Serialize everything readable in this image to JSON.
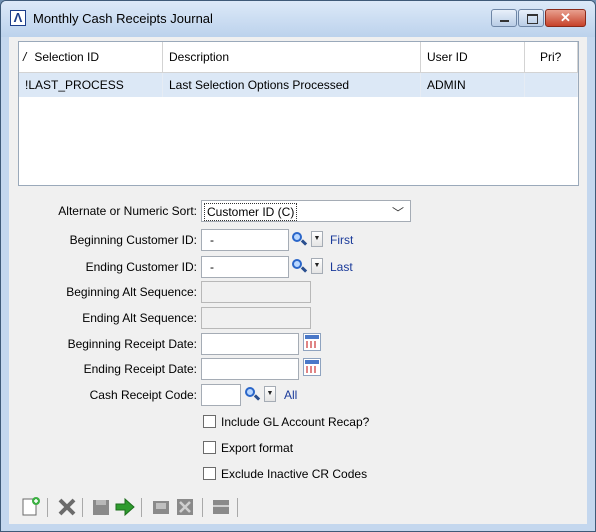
{
  "window": {
    "title": "Monthly Cash Receipts Journal"
  },
  "grid": {
    "sort_indicator": "/",
    "columns": [
      "Selection ID",
      "Description",
      "User ID",
      "Pri?"
    ],
    "rows": [
      [
        "!LAST_PROCESS",
        "Last Selection Options Processed",
        "ADMIN",
        ""
      ]
    ]
  },
  "form": {
    "alt_sort_label": "Alternate or Numeric Sort:",
    "alt_sort_value": "Customer ID (C)",
    "beg_cust_label": "Beginning Customer ID:",
    "beg_cust_value": "-",
    "beg_cust_link": "First",
    "end_cust_label": "Ending Customer ID:",
    "end_cust_value": "-",
    "end_cust_link": "Last",
    "beg_alt_label": "Beginning Alt Sequence:",
    "end_alt_label": "Ending Alt Sequence:",
    "beg_date_label": "Beginning Receipt Date:",
    "end_date_label": "Ending Receipt Date:",
    "cr_code_label": "Cash Receipt Code:",
    "cr_code_link": "All",
    "cb_gl_recap": "Include GL Account Recap?",
    "cb_export": "Export format",
    "cb_exclude": "Exclude Inactive CR Codes"
  },
  "toolbar": {
    "icons": [
      "new-icon",
      "delete-icon",
      "save-icon",
      "run-icon",
      "print-icon",
      "exit-icon",
      "options-icon"
    ]
  }
}
